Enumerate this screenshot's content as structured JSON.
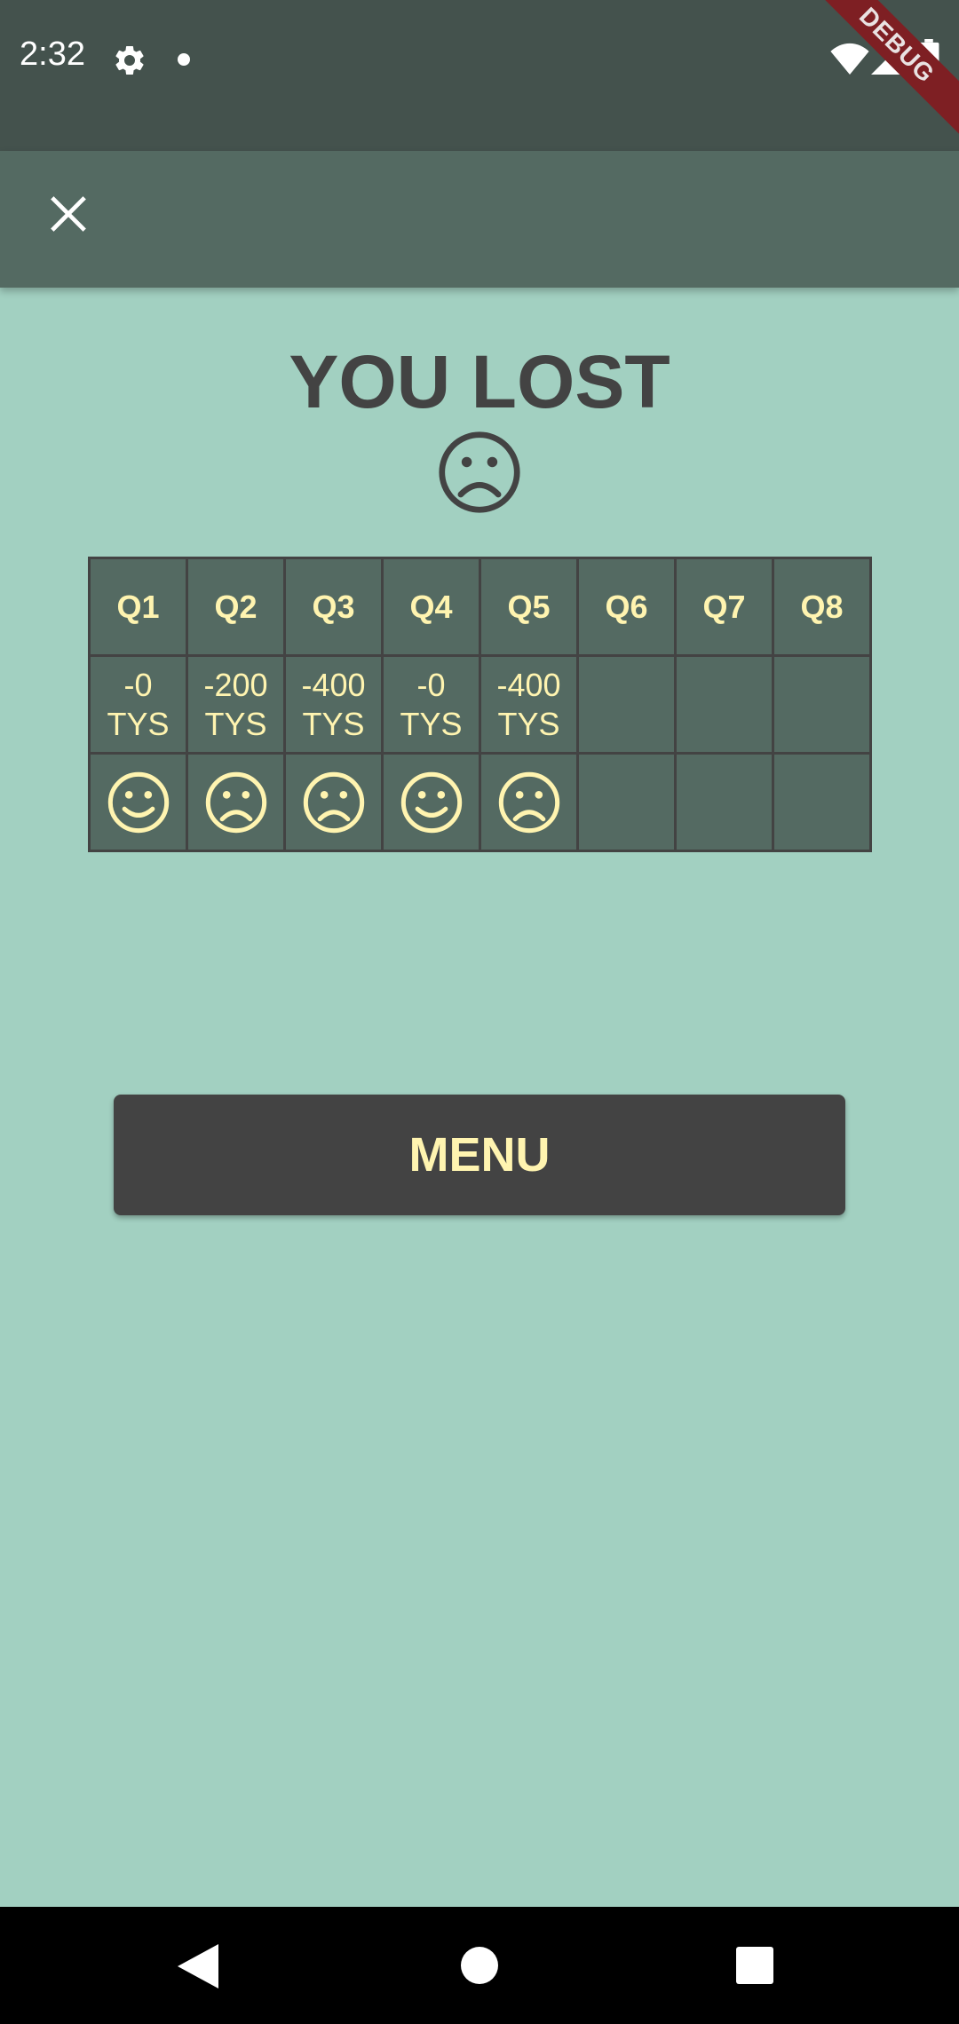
{
  "status_bar": {
    "time": "2:32",
    "debug_label": "DEBUG"
  },
  "app_bar": {
    "close_icon": "close-icon"
  },
  "result": {
    "title": "YOU LOST",
    "face": "sad-face-icon"
  },
  "score_table": {
    "headers": [
      "Q1",
      "Q2",
      "Q3",
      "Q4",
      "Q5",
      "Q6",
      "Q7",
      "Q8"
    ],
    "amounts": [
      [
        "-0",
        "TYS"
      ],
      [
        "-200",
        "TYS"
      ],
      [
        "-400",
        "TYS"
      ],
      [
        "-0",
        "TYS"
      ],
      [
        "-400",
        "TYS"
      ],
      [
        "",
        ""
      ],
      [
        "",
        ""
      ],
      [
        "",
        ""
      ]
    ],
    "faces": [
      "happy",
      "sad",
      "sad",
      "happy",
      "sad",
      "",
      "",
      ""
    ]
  },
  "menu_button": {
    "label": "MENU"
  },
  "colors": {
    "background": "#a2d0c1",
    "status_bar": "#44524d",
    "app_bar": "#546a62",
    "dark_text": "#434343",
    "accent_text": "#fff4b0",
    "debug_banner": "#7e1f23"
  }
}
